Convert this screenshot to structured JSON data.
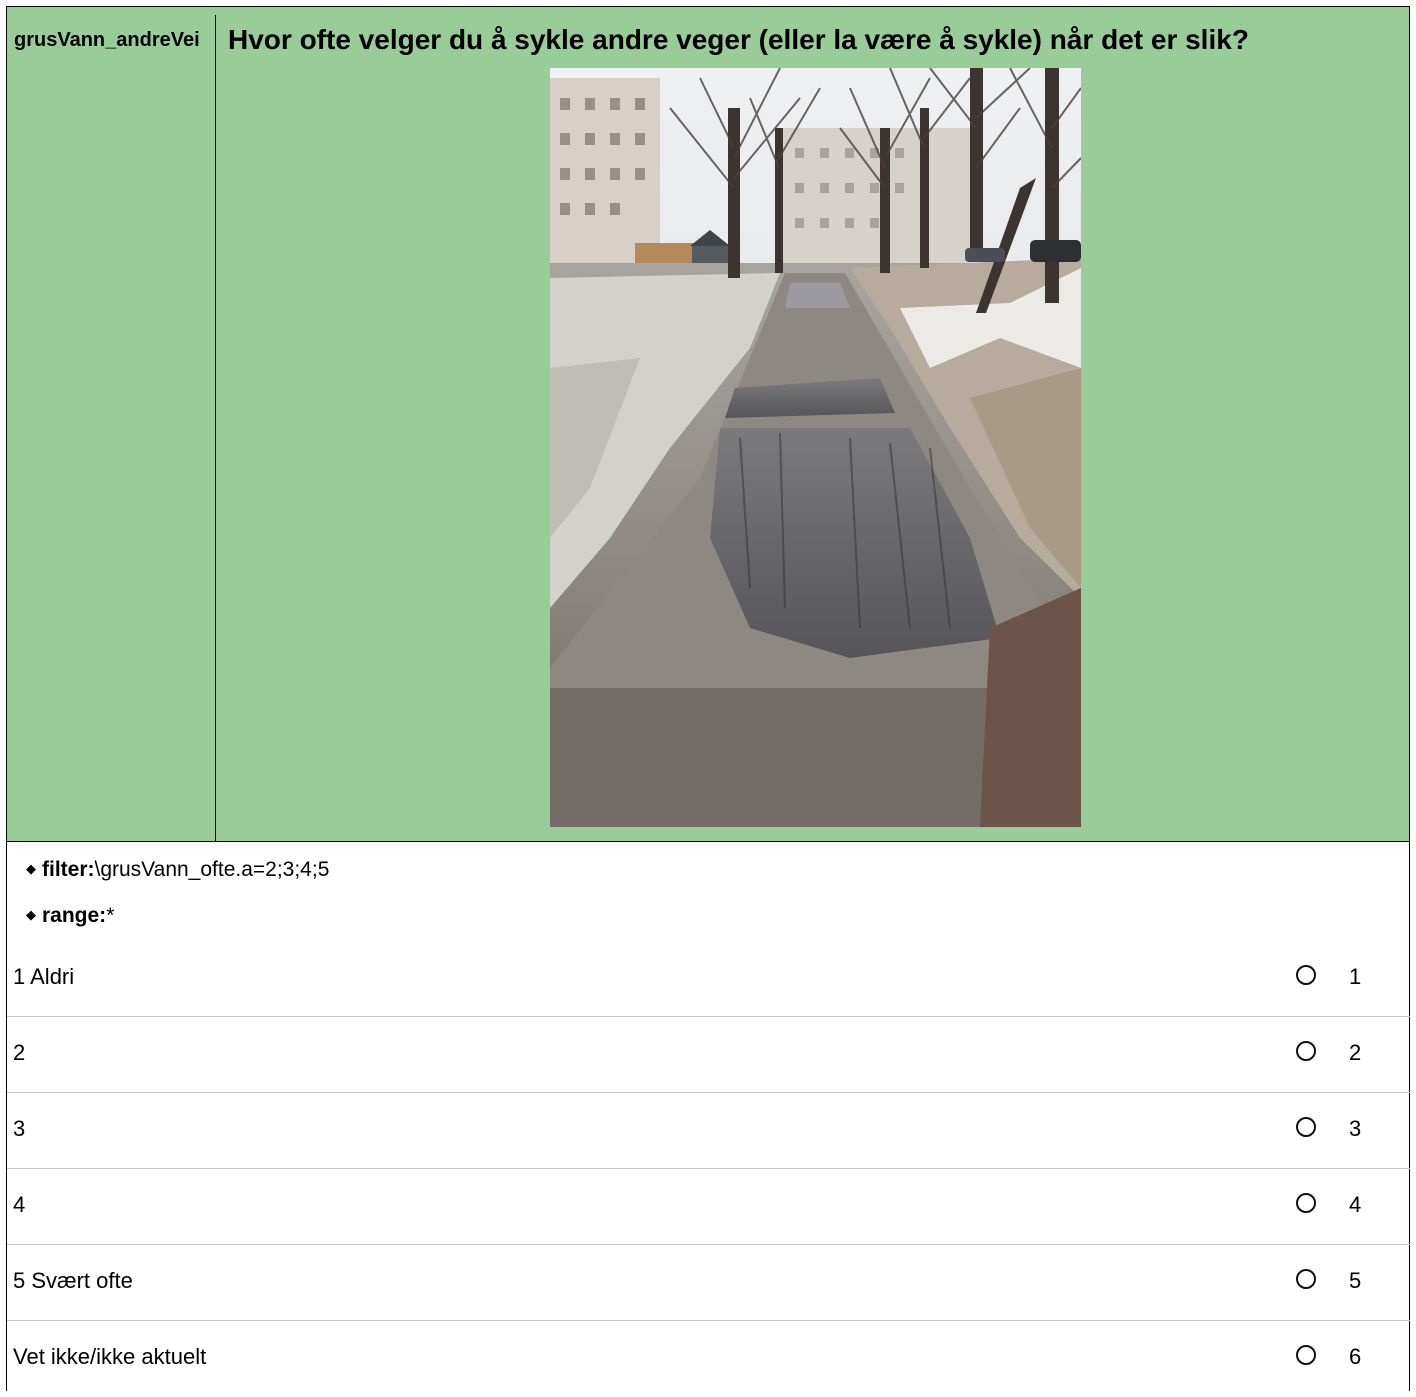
{
  "question": {
    "variable": "grusVann_andreVei",
    "text": "Hvor ofte velger du å sykle andre veger (eller la være å sykle) når det er slik?"
  },
  "meta": {
    "filter_label": "filter:",
    "filter_value": "\\grusVann_ofte.a=2;3;4;5",
    "range_label": "range:",
    "range_value": "*"
  },
  "options": [
    {
      "label": "1 Aldri",
      "code": "1"
    },
    {
      "label": "2",
      "code": "2"
    },
    {
      "label": "3",
      "code": "3"
    },
    {
      "label": "4",
      "code": "4"
    },
    {
      "label": "5 Svært ofte",
      "code": "5"
    },
    {
      "label": "Vet ikke/ikke aktuelt",
      "code": "6"
    }
  ],
  "colors": {
    "header_bg": "#99cc99",
    "row_divider": "#c8c8c8"
  }
}
